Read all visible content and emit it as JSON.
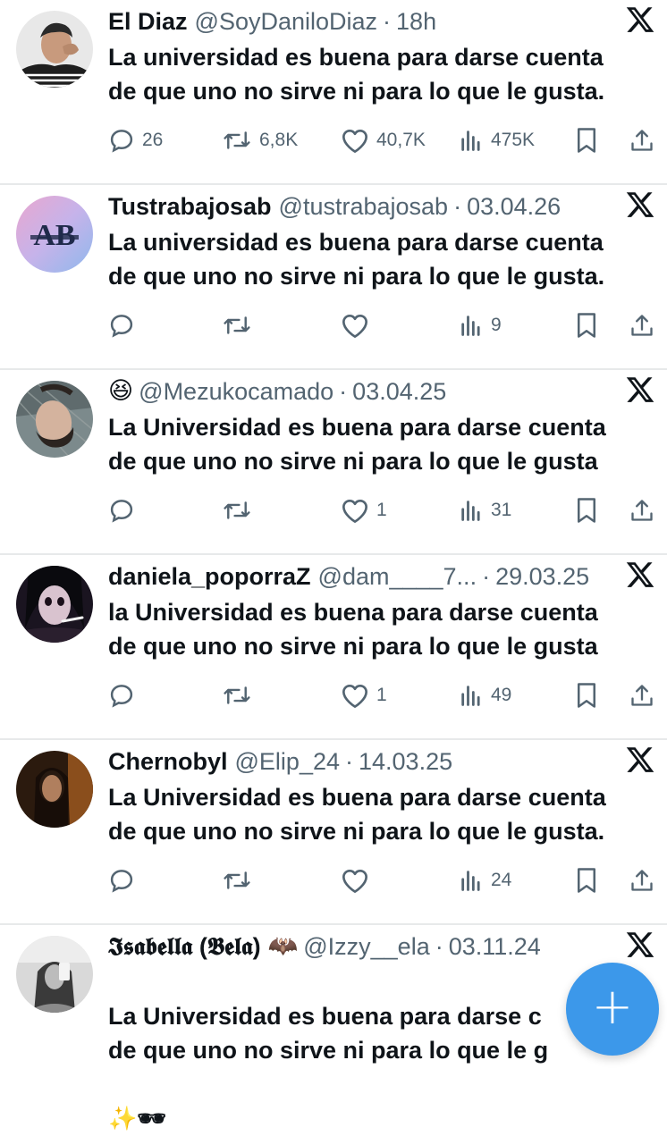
{
  "tweets": [
    {
      "name": "El Diaz",
      "emoji": "",
      "handle": "@SoyDaniloDiaz",
      "date": "18h",
      "text": "La universidad es buena para darse cuenta\nde que uno no sirve ni para lo que le gusta.",
      "replies": "26",
      "retweets": "6,8K",
      "likes": "40,7K",
      "views": "475K",
      "avatar_icon": "person-photo-avatar"
    },
    {
      "name": "Tustrabajosab",
      "emoji": "",
      "handle": "@tustrabajosab",
      "date": "03.04.26",
      "text": "La universidad es buena para darse cuenta\nde que uno no sirve ni para lo que le gusta.",
      "replies": "",
      "retweets": "",
      "likes": "",
      "views": "9",
      "avatar_icon": "ab-logo-avatar",
      "avatar_text": "AB"
    },
    {
      "name": "",
      "emoji": "😆",
      "handle": "@Mezukocamado",
      "date": "03.04.25",
      "text": "La Universidad es buena para darse cuenta\nde que uno no sirve ni para lo que le gusta",
      "replies": "",
      "retweets": "",
      "likes": "1",
      "views": "31",
      "avatar_icon": "person-photo-avatar"
    },
    {
      "name": "daniela_poporraZ",
      "emoji": "",
      "handle": "@dam____7...",
      "date": "29.03.25",
      "text": "la Universidad es buena para darse cuenta\nde que uno no sirve ni para lo que le gusta",
      "replies": "",
      "retweets": "",
      "likes": "1",
      "views": "49",
      "avatar_icon": "person-photo-avatar"
    },
    {
      "name": "Chernobyl",
      "emoji": "",
      "handle": "@Elip_24",
      "date": "14.03.25",
      "text": "La Universidad es buena para darse cuenta\nde que uno no sirve ni para lo que le gusta.",
      "replies": "",
      "retweets": "",
      "likes": "",
      "views": "24",
      "avatar_icon": "person-photo-avatar"
    },
    {
      "name": "𝕴𝖘𝖆𝖇𝖊𝖑𝖑𝖆 (𝕭𝖊𝖑𝖆)",
      "emoji": "🦇",
      "handle": "@Izzy__ela",
      "date": "03.11.24",
      "text": "La Universidad es buena para darse c\nde que uno no sirve ni para lo que le g",
      "text_extra": "✨🕶",
      "avatar_icon": "person-photo-avatar"
    }
  ],
  "icons": {
    "platform": "x-logo",
    "reply": "reply-icon",
    "retweet": "retweet-icon",
    "like": "like-icon",
    "views": "views-icon",
    "bookmark": "bookmark-icon",
    "share": "share-icon",
    "compose": "plus-icon"
  },
  "fab": {
    "label": "+"
  },
  "colors": {
    "accent": "#3c98ea",
    "text": "#0f1419",
    "muted": "#536471",
    "separator": "#e7e9ea"
  }
}
